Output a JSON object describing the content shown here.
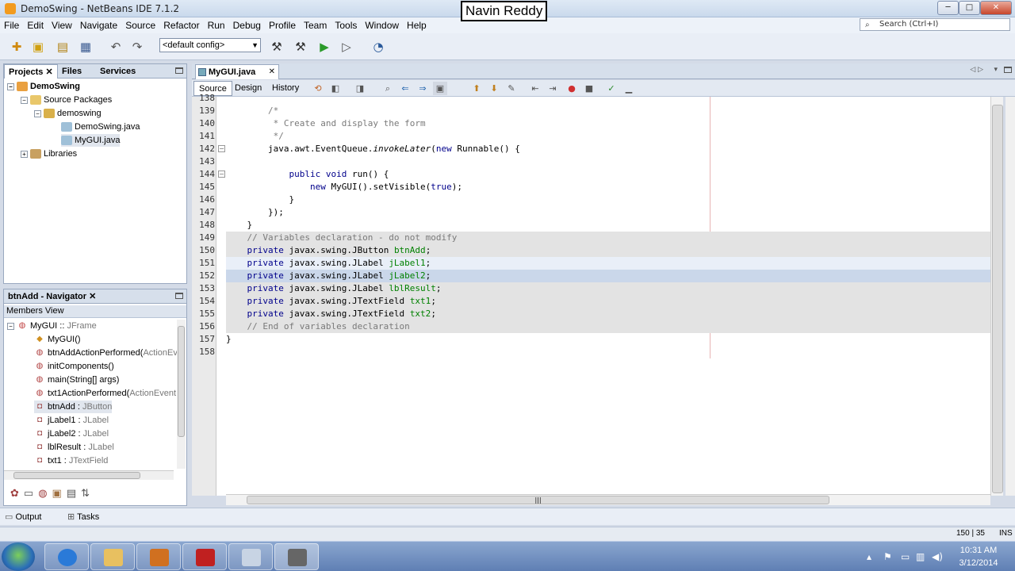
{
  "window": {
    "title": "DemoSwing - NetBeans IDE 7.1.2",
    "min": "─",
    "max": "□",
    "close": "✕"
  },
  "watermark": "Navin Reddy",
  "menu": [
    "File",
    "Edit",
    "View",
    "Navigate",
    "Source",
    "Refactor",
    "Run",
    "Debug",
    "Profile",
    "Team",
    "Tools",
    "Window",
    "Help"
  ],
  "search": {
    "placeholder": "Search (Ctrl+I)"
  },
  "toolbar": {
    "config": "<default config>"
  },
  "projects_panel": {
    "tabs": [
      "Projects",
      "Files",
      "Services"
    ],
    "tree": [
      {
        "label": "DemoSwing"
      },
      {
        "label": "Source Packages"
      },
      {
        "label": "demoswing"
      },
      {
        "label": "DemoSwing.java"
      },
      {
        "label": "MyGUI.java"
      },
      {
        "label": "Libraries"
      }
    ]
  },
  "navigator": {
    "title": "btnAdd - Navigator",
    "view": "Members View",
    "members": [
      {
        "name": "MyGUI :: ",
        "type": "JFrame"
      },
      {
        "name": "MyGUI()",
        "type": ""
      },
      {
        "name": "btnAddActionPerformed(",
        "type": "ActionEve"
      },
      {
        "name": "initComponents()",
        "type": ""
      },
      {
        "name": "main(String[] args)",
        "type": ""
      },
      {
        "name": "txt1ActionPerformed(",
        "type": "ActionEvent e"
      },
      {
        "name": "btnAdd : ",
        "type": "JButton"
      },
      {
        "name": "jLabel1 : ",
        "type": "JLabel"
      },
      {
        "name": "jLabel2 : ",
        "type": "JLabel"
      },
      {
        "name": "lblResult : ",
        "type": "JLabel"
      },
      {
        "name": "txt1 : ",
        "type": "JTextField"
      }
    ]
  },
  "editor": {
    "tab": "MyGUI.java",
    "tab_close": "✕",
    "views": [
      "Source",
      "Design",
      "History"
    ],
    "lines": [
      {
        "n": "138",
        "t": ""
      },
      {
        "n": "139",
        "t": "        /*"
      },
      {
        "n": "140",
        "t": "         * Create and display the form"
      },
      {
        "n": "141",
        "t": "         */"
      },
      {
        "n": "142",
        "t": "        java.awt.EventQueue.invokeLater(new Runnable() {"
      },
      {
        "n": "143",
        "t": ""
      },
      {
        "n": "144",
        "t": "            public void run() {"
      },
      {
        "n": "145",
        "t": "                new MyGUI().setVisible(true);"
      },
      {
        "n": "146",
        "t": "            }"
      },
      {
        "n": "147",
        "t": "        });"
      },
      {
        "n": "148",
        "t": "    }"
      },
      {
        "n": "149",
        "t": "    // Variables declaration - do not modify"
      },
      {
        "n": "150",
        "t": "    private javax.swing.JButton btnAdd;"
      },
      {
        "n": "151",
        "t": "    private javax.swing.JLabel jLabel1;"
      },
      {
        "n": "152",
        "t": "    private javax.swing.JLabel jLabel2;"
      },
      {
        "n": "153",
        "t": "    private javax.swing.JLabel lblResult;"
      },
      {
        "n": "154",
        "t": "    private javax.swing.JTextField txt1;"
      },
      {
        "n": "155",
        "t": "    private javax.swing.JTextField txt2;"
      },
      {
        "n": "156",
        "t": "    // End of variables declaration"
      },
      {
        "n": "157",
        "t": "}"
      },
      {
        "n": "158",
        "t": ""
      }
    ]
  },
  "bottom": {
    "output": "Output",
    "tasks": "Tasks"
  },
  "status": {
    "caret": "150 | 35",
    "mode": "INS"
  },
  "clock": {
    "time": "10:31 AM",
    "date": "3/12/2014"
  }
}
